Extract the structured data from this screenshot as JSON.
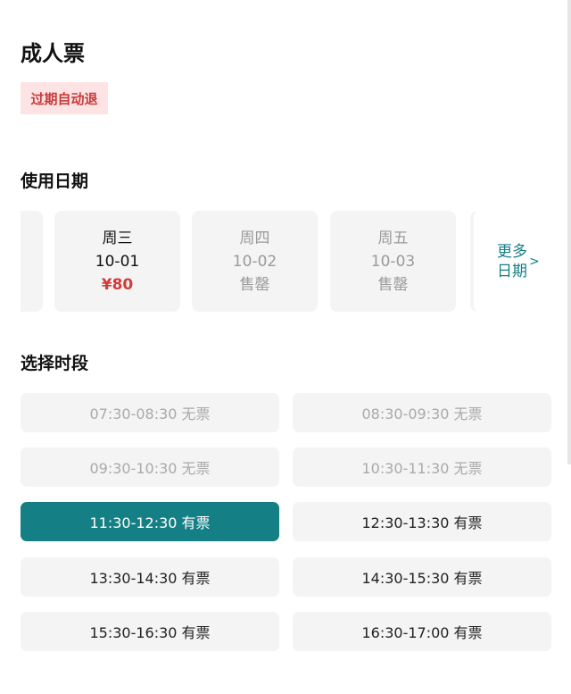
{
  "ticket": {
    "title": "成人票",
    "badge": "过期自动退"
  },
  "date_section": {
    "heading": "使用日期",
    "dates": [
      {
        "weekday": "周三",
        "date": "10-01",
        "status": "¥80",
        "state": "selected"
      },
      {
        "weekday": "周四",
        "date": "10-02",
        "status": "售罄",
        "state": "soldout"
      },
      {
        "weekday": "周五",
        "date": "10-03",
        "status": "售罄",
        "state": "soldout"
      }
    ],
    "more_line1": "更多",
    "more_line2": "日期",
    "more_chevron": ">"
  },
  "time_section": {
    "heading": "选择时段",
    "slots": [
      {
        "label": "07:30-08:30 无票",
        "state": "none"
      },
      {
        "label": "08:30-09:30 无票",
        "state": "none"
      },
      {
        "label": "09:30-10:30 无票",
        "state": "none"
      },
      {
        "label": "10:30-11:30 无票",
        "state": "none"
      },
      {
        "label": "11:30-12:30 有票",
        "state": "selected"
      },
      {
        "label": "12:30-13:30 有票",
        "state": "available"
      },
      {
        "label": "13:30-14:30 有票",
        "state": "available"
      },
      {
        "label": "14:30-15:30 有票",
        "state": "available"
      },
      {
        "label": "15:30-16:30 有票",
        "state": "available"
      },
      {
        "label": "16:30-17:00 有票",
        "state": "available"
      }
    ]
  },
  "colors": {
    "accent": "#157f86",
    "price": "#d23b3b",
    "badge_bg": "#fde3e3",
    "badge_text": "#c83b3b"
  }
}
